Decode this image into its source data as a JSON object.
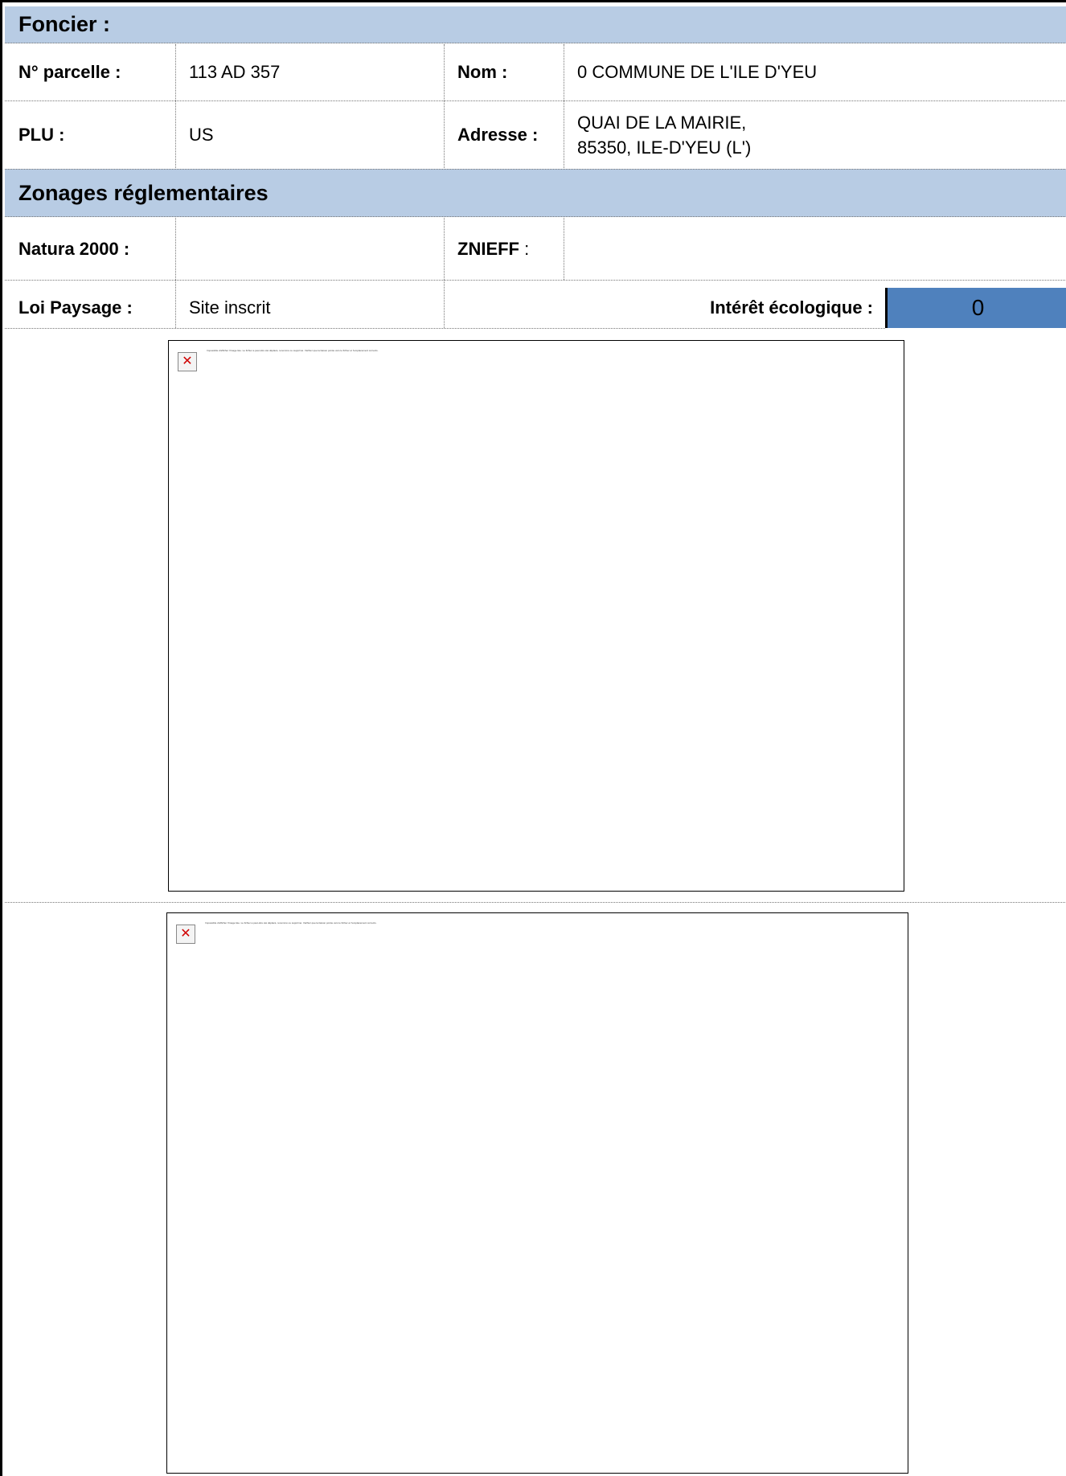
{
  "foncier": {
    "title": "Foncier :",
    "parcelle_label": "N° parcelle :",
    "parcelle_value": "113 AD 357",
    "nom_label": "Nom :",
    "nom_value": "0 COMMUNE DE L'ILE D'YEU",
    "plu_label": "PLU :",
    "plu_value": "US",
    "adresse_label": "Adresse :",
    "adresse_line1": "QUAI DE LA MAIRIE,",
    "adresse_line2": "85350, ILE-D'YEU (L')"
  },
  "zonages": {
    "title": "Zonages réglementaires",
    "natura_label": "Natura 2000 :",
    "natura_value": "",
    "znieff_label": "ZNIEFF",
    "znieff_sep": " :",
    "znieff_value": "",
    "loi_label": "Loi Paysage :",
    "loi_value": "Site inscrit",
    "interet_label": "Intérêt écologique :",
    "interet_value": "0",
    "interet_color": "#4f81bd"
  },
  "images": [
    {
      "icon": "broken-image-icon",
      "error_text": "Impossible d'afficher l'image liée. Le fichier a peut-être été déplacé, renommé ou supprimé. Vérifiez que la liaison pointe vers le fichier et l'emplacement corrects."
    },
    {
      "icon": "broken-image-icon",
      "error_text": "Impossible d'afficher l'image liée. Le fichier a peut-être été déplacé, renommé ou supprimé. Vérifiez que la liaison pointe vers le fichier et l'emplacement corrects."
    }
  ],
  "colors": {
    "header_bg": "#b8cce4",
    "score_bg": "#4f81bd"
  }
}
